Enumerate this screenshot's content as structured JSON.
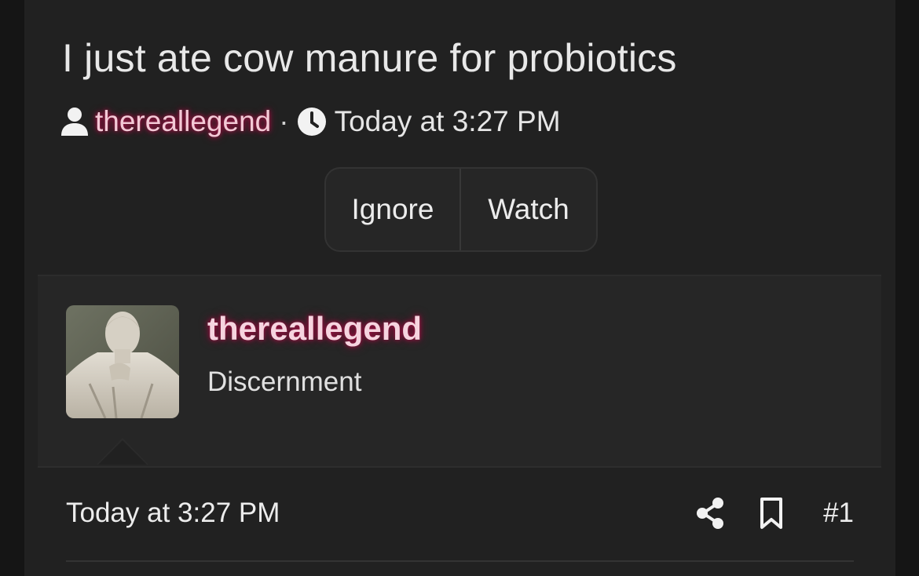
{
  "thread": {
    "title": "I just ate cow manure for probiotics",
    "author": "thereallegend",
    "separator": "·",
    "timestamp": "Today at 3:27 PM"
  },
  "actions": {
    "ignore_label": "Ignore",
    "watch_label": "Watch"
  },
  "post": {
    "username": "thereallegend",
    "user_title": "Discernment",
    "date": "Today at 3:27 PM",
    "number": "#1"
  },
  "icons": {
    "author": "user-icon",
    "time": "clock-icon",
    "share": "share-icon",
    "bookmark": "bookmark-icon"
  },
  "colors": {
    "background": "#212121",
    "username_glow": "#b0124a"
  }
}
